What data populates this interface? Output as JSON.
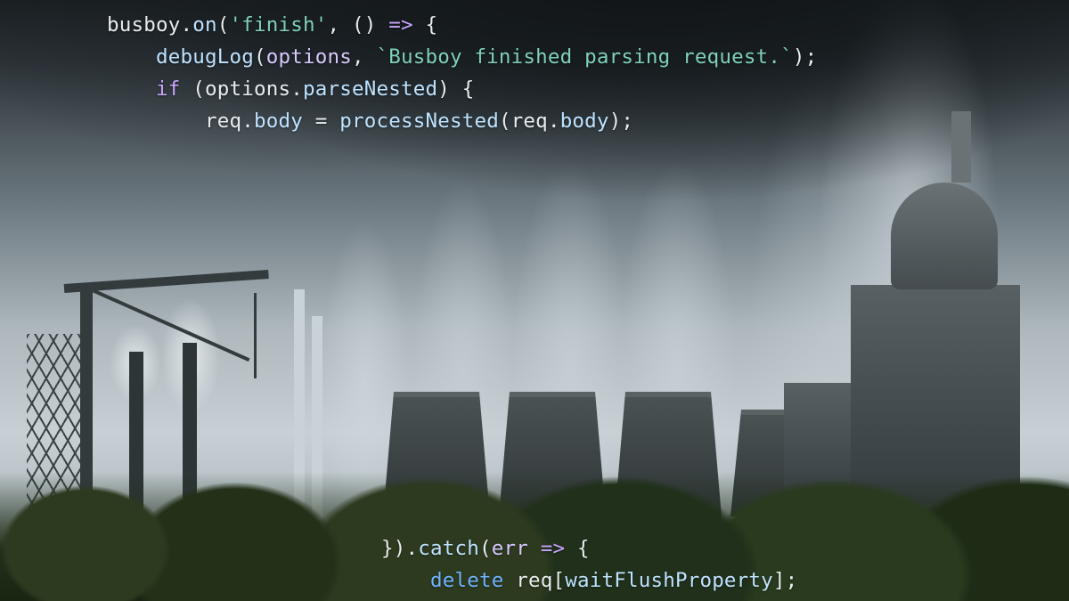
{
  "code_top": {
    "l1": {
      "a": "busboy",
      "b": ".",
      "c": "on",
      "d": "(",
      "e": "'finish'",
      "f": ", () ",
      "g": "=>",
      "h": " {"
    },
    "l2": {
      "indent": "    ",
      "a": "debugLog",
      "b": "(",
      "c": "options",
      "d": ", ",
      "e": "`Busboy finished parsing request.`",
      "f": ");"
    },
    "l3": {
      "indent": "    ",
      "a": "if",
      "b": " (",
      "c": "options",
      "d": ".",
      "e": "parseNested",
      "f": ") {"
    },
    "l4": {
      "indent": "        ",
      "a": "req",
      "b": ".",
      "c": "body",
      "d": " = ",
      "e": "processNested",
      "f": "(",
      "g": "req",
      "h": ".",
      "i": "body",
      "j": ");"
    }
  },
  "code_bottom": {
    "l1": {
      "a": "}).",
      "b": "catch",
      "c": "(",
      "d": "err",
      "e": " ",
      "f": "=>",
      "g": " {"
    },
    "l2": {
      "indent": "    ",
      "a": "delete",
      "b": " ",
      "c": "req",
      "d": "[",
      "e": "waitFlushProperty",
      "f": "];"
    }
  }
}
